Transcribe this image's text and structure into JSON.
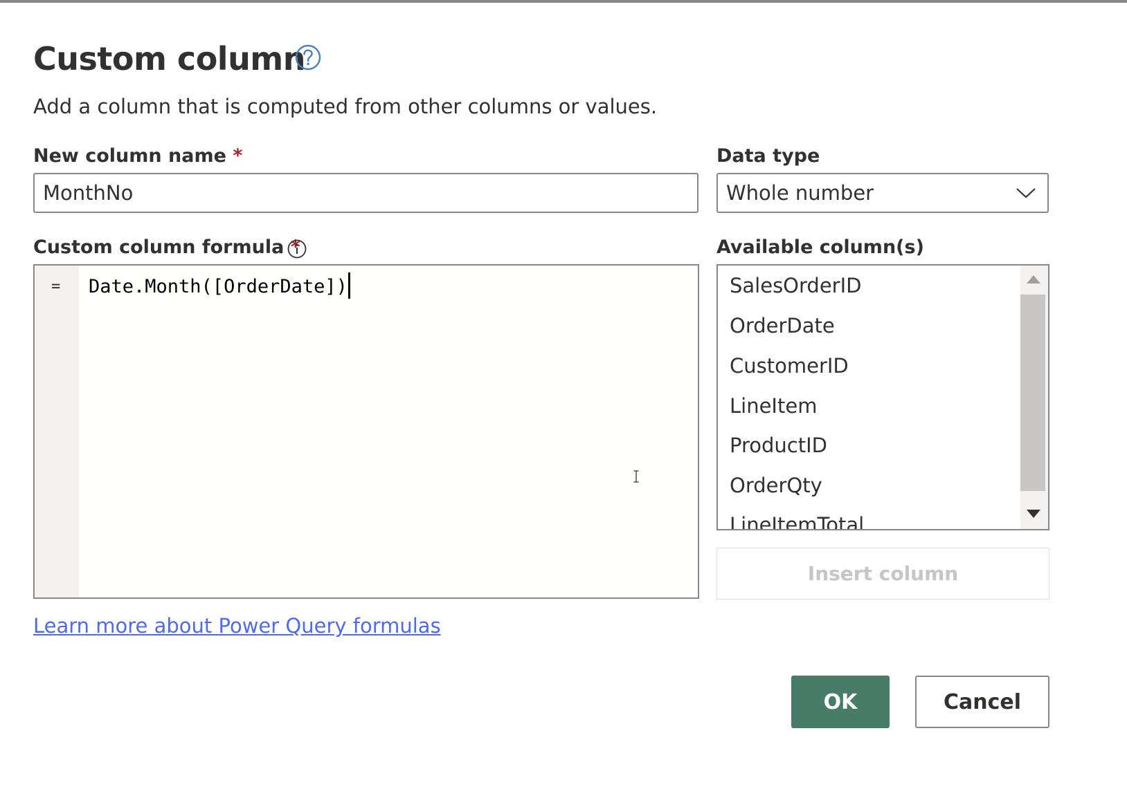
{
  "dialog": {
    "title": "Custom column",
    "subtitle": "Add a column that is computed from other columns or values.",
    "help_icon": "question-circle-icon"
  },
  "name_field": {
    "label": "New column name",
    "required_mark": "*",
    "value": "MonthNo"
  },
  "data_type": {
    "label": "Data type",
    "value": "Whole number",
    "chevron_icon": "chevron-down-icon"
  },
  "formula": {
    "label": "Custom column formula",
    "required_mark": "*",
    "info_icon": "info-icon",
    "gutter_symbol": "=",
    "code": "Date.Month([OrderDate])"
  },
  "available_columns": {
    "label": "Available column(s)",
    "items": [
      "SalesOrderID",
      "OrderDate",
      "CustomerID",
      "LineItem",
      "ProductID",
      "OrderQty",
      "LineItemTotal"
    ]
  },
  "insert_button": {
    "label": "Insert column"
  },
  "learn_more_link": {
    "text": "Learn more about Power Query formulas"
  },
  "buttons": {
    "ok": "OK",
    "cancel": "Cancel"
  },
  "colors": {
    "primary": "#477c68",
    "link": "#4f6bed",
    "required": "#a4262c",
    "help_icon": "#4a7fc1"
  }
}
